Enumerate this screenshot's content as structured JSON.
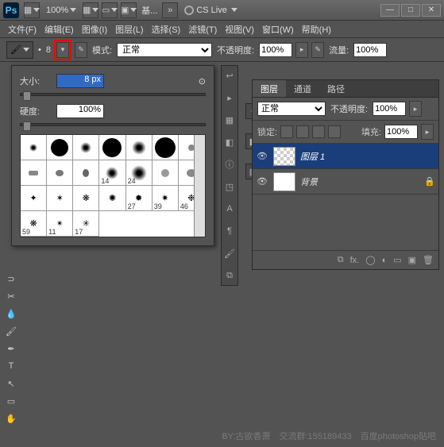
{
  "title": {
    "ps": "Ps",
    "zoom": "100%",
    "doc": "基...",
    "cslive": "CS Live"
  },
  "win": {
    "min": "—",
    "max": "□",
    "close": "✕"
  },
  "menu": [
    "文件(F)",
    "编辑(E)",
    "图像(I)",
    "图层(L)",
    "选择(S)",
    "滤镜(T)",
    "视图(V)",
    "窗口(W)",
    "帮助(H)"
  ],
  "opt": {
    "brushsize": "8",
    "mode_lbl": "模式:",
    "mode_val": "正常",
    "opacity_lbl": "不透明度:",
    "opacity_val": "100%",
    "flow_lbl": "流量:",
    "flow_val": "100%"
  },
  "bp": {
    "size_lbl": "大小:",
    "size_val": "8 px",
    "hard_lbl": "硬度:",
    "hard_val": "100%",
    "nums": [
      "27",
      "39",
      "46",
      "59",
      "11",
      "17"
    ]
  },
  "tabs": {
    "layers": "图层",
    "channels": "通道",
    "paths": "路径"
  },
  "rp": {
    "mode": "正常",
    "opacity_lbl": "不透明度:",
    "opacity_val": "100%",
    "lock_lbl": "锁定:",
    "fill_lbl": "填充:",
    "fill_val": "100%"
  },
  "layers": [
    {
      "name": "图层 1"
    },
    {
      "name": "背景"
    }
  ],
  "foot": {
    "fx": "fx."
  },
  "wm": "BY:古欲香萧　交流群:155189433　百度photoshop贴吧"
}
